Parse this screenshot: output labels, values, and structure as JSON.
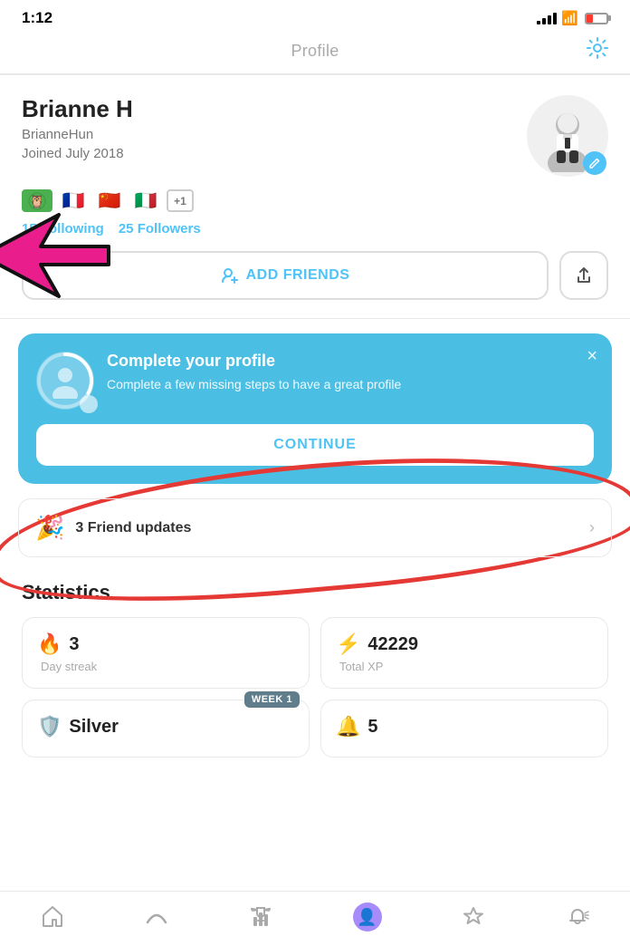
{
  "statusBar": {
    "time": "1:12",
    "signalBars": [
      3,
      5,
      7,
      9,
      11
    ],
    "wifi": "wifi",
    "battery": "battery"
  },
  "header": {
    "title": "Profile",
    "gearIcon": "⚙️"
  },
  "profile": {
    "name": "Brianne H",
    "username": "BrianneHun",
    "joined": "Joined July 2018",
    "avatarAlt": "profile avatar",
    "editIcon": "✏️"
  },
  "flags": [
    "🌿",
    "🇫🇷",
    "🇨🇳",
    "🇮🇹"
  ],
  "flagMore": "+1",
  "social": {
    "following": "15 Following",
    "followers": "25 Followers"
  },
  "actions": {
    "addFriends": "ADD FRIENDS",
    "addIcon": "person-add",
    "shareIcon": "share"
  },
  "completeProfile": {
    "title": "Complete your profile",
    "description": "Complete a few missing steps to have a great profile",
    "continueLabel": "CONTINUE",
    "closeIcon": "×"
  },
  "friendUpdates": {
    "label": "3 Friend updates",
    "emoji": "🎉",
    "emoji2": "🎊"
  },
  "statistics": {
    "title": "Statistics",
    "cards": [
      {
        "icon": "🔥",
        "value": "3",
        "label": "Day streak"
      },
      {
        "icon": "⚡",
        "value": "42229",
        "label": "Total XP"
      },
      {
        "icon": "🛡️",
        "value": "Silver",
        "label": "",
        "badge": "WEEK 1"
      },
      {
        "icon": "🔔",
        "value": "5",
        "label": ""
      }
    ]
  },
  "nav": {
    "items": [
      {
        "icon": "🏠",
        "label": "home",
        "active": false
      },
      {
        "icon": "∪",
        "label": "learn",
        "active": false
      },
      {
        "icon": "🏆",
        "label": "leaderboard",
        "active": false
      },
      {
        "icon": "👤",
        "label": "profile",
        "active": true
      },
      {
        "icon": "🛡",
        "label": "quests",
        "active": false
      },
      {
        "icon": "📣",
        "label": "notifications",
        "active": false
      }
    ]
  }
}
